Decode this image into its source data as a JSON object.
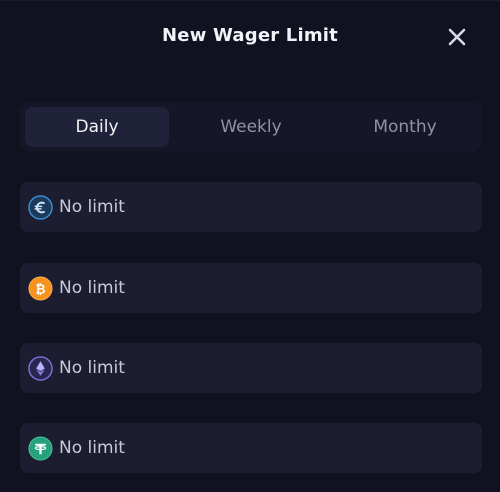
{
  "modal": {
    "title": "New Wager Limit"
  },
  "tabs": [
    {
      "label": "Daily",
      "active": true
    },
    {
      "label": "Weekly",
      "active": false
    },
    {
      "label": "Monthy",
      "active": false
    }
  ],
  "limits": [
    {
      "currency_icon": "euro-icon",
      "value": "No limit",
      "color": "#3a8fd6"
    },
    {
      "currency_icon": "bitcoin-icon",
      "value": "No limit",
      "color": "#f7931a"
    },
    {
      "currency_icon": "ethereum-icon",
      "value": "No limit",
      "color": "#7b74d8"
    },
    {
      "currency_icon": "tether-icon",
      "value": "No limit",
      "color": "#26a17b"
    }
  ]
}
